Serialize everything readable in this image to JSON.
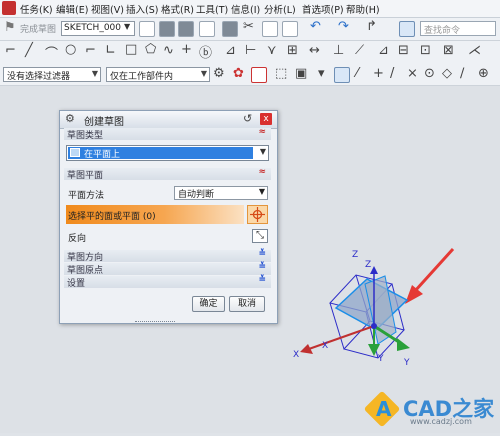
{
  "menu": [
    "任务(K)",
    "编辑(E)",
    "视图(V)",
    "插入(S)",
    "格式(R)",
    "工具(T)",
    "信息(I)",
    "分析(L)",
    "首选项(P)",
    "帮助(H)"
  ],
  "toolbar": {
    "finish_sketch_label": "完成草图",
    "sketch_name": "SKETCH_000",
    "search_placeholder": "查找命令"
  },
  "filters": {
    "selection_filter": "没有选择过滤器",
    "scope": "仅在工作部件内"
  },
  "dialog": {
    "title": "创建草图",
    "section_sketch_type": "草图类型",
    "sketch_type_value": "在平面上",
    "section_sketch_plane": "草图平面",
    "plane_method_label": "平面方法",
    "plane_method_value": "自动判断",
    "select_plane_label": "选择平的面或平面 (0)",
    "reverse_label": "反向",
    "section_sketch_orientation": "草图方向",
    "section_sketch_origin": "草图原点",
    "section_settings": "设置",
    "ok_label": "确定",
    "cancel_label": "取消"
  },
  "axes": {
    "x": "X",
    "y": "Y",
    "z": "Z"
  },
  "watermark": {
    "brand": "CAD之家",
    "url": "www.cadzj.com"
  },
  "colors": {
    "accent": "#f08a1c",
    "selection_blue": "#2f80e0",
    "arrow_red": "#e53935"
  }
}
